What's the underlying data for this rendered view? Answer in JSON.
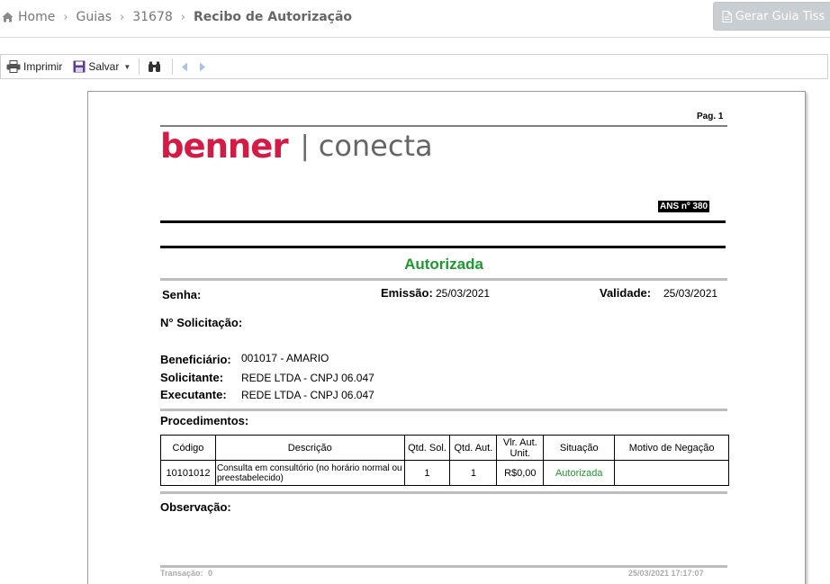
{
  "breadcrumb": {
    "home": "Home",
    "guias": "Guias",
    "id": "31678",
    "current": "Recibo de Autorização",
    "separator": "›"
  },
  "header": {
    "gerar_button": "Gerar Guia Tiss"
  },
  "toolbar": {
    "print": "Imprimir",
    "save": "Salvar",
    "save_caret": "▼"
  },
  "report": {
    "page_label": "Pag. 1",
    "logo_brand": "benner",
    "logo_bar": "|",
    "logo_product": "conecta",
    "ans": "ANS nº 380",
    "status": "Autorizada",
    "senha_label": "Senha:",
    "senha_value": "",
    "emissao_label": "Emissão:",
    "emissao_value": "25/03/2021",
    "validade_label": "Validade:",
    "validade_value": "25/03/2021",
    "solicitacao_label": "N° Solicitação:",
    "beneficiario_label": "Beneficiário:",
    "beneficiario_value": "001017 - AMARIO",
    "solicitante_label": "Solicitante:",
    "solicitante_value": "REDE LTDA - CNPJ 06.047",
    "executante_label": "Executante:",
    "executante_value": "REDE LTDA - CNPJ 06.047",
    "procedimentos_label": "Procedimentos:",
    "table": {
      "headers": [
        "Código",
        "Descrição",
        "Qtd. Sol.",
        "Qtd. Aut.",
        "Vlr. Aut. Unit.",
        "Situação",
        "Motivo de Negação"
      ],
      "rows": [
        [
          "10101012",
          "Consulta em consultório (no horário normal ou preestabelecido)",
          "1",
          "1",
          "R$0,00",
          "Autorizada",
          ""
        ]
      ]
    },
    "observacao_label": "Observação:",
    "transacao_label": "Transação:",
    "transacao_value": "0",
    "footer_timestamp": "25/03/2021 17:17:07"
  },
  "colors": {
    "brand_red": "#d31b46",
    "status_green": "#1b9a2d",
    "save_icon_purple": "#5b3f8c"
  }
}
